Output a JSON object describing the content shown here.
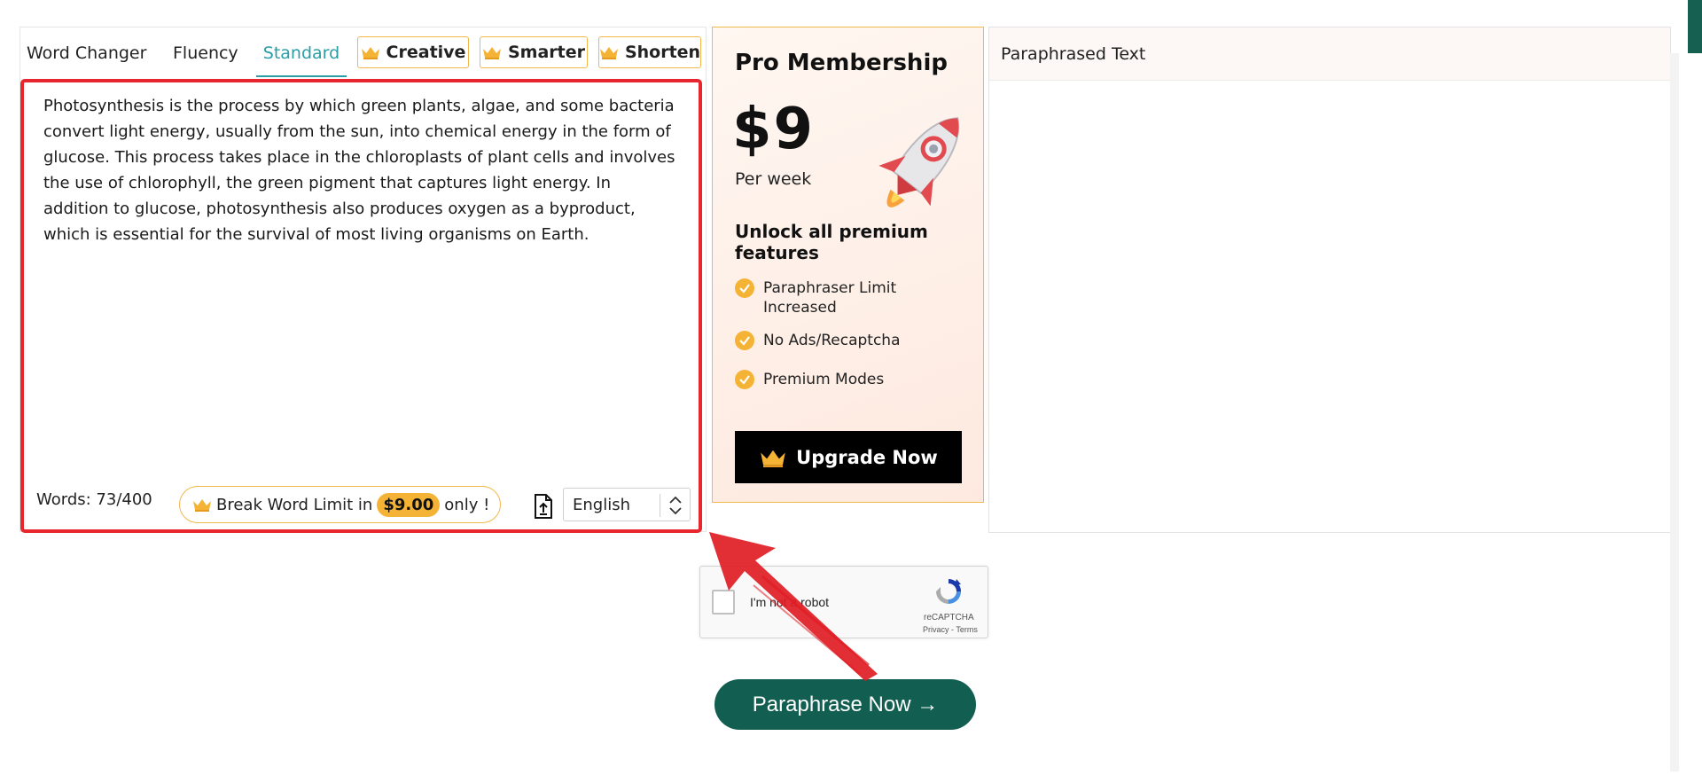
{
  "tabs": {
    "word_changer": "Word Changer",
    "fluency": "Fluency",
    "standard": "Standard",
    "creative": "Creative",
    "smarter": "Smarter",
    "shorten": "Shorten",
    "active": "Standard"
  },
  "editor": {
    "text": "Photosynthesis is the process by which green plants, algae, and some bacteria convert light energy, usually from the sun, into chemical energy in the form of glucose. This process takes place in the chloroplasts of plant cells and involves the use of chlorophyll, the green pigment that captures light energy. In addition to glucose, photosynthesis also produces oxygen as a byproduct, which is essential for the survival of most living organisms on Earth.",
    "word_count": "Words: 73/400",
    "break_limit_prefix": "Break Word Limit in",
    "break_limit_price": "$9.00",
    "break_limit_suffix": "only !",
    "language": "English"
  },
  "promo": {
    "title": "Pro Membership",
    "price": "$9",
    "period": "Per week",
    "subtitle": "Unlock all premium features",
    "features": [
      "Paraphraser Limit Increased",
      "No Ads/Recaptcha",
      "Premium Modes"
    ],
    "upgrade_label": "Upgrade Now"
  },
  "output": {
    "title": "Paraphrased Text",
    "text": ""
  },
  "captcha": {
    "label": "I'm not a robot",
    "brand": "reCAPTCHA",
    "links": "Privacy - Terms"
  },
  "cta": {
    "label": "Paraphrase Now →"
  },
  "colors": {
    "accent_teal": "#2a9da6",
    "premium_gold": "#f2b84b",
    "highlight_red": "#e8262e",
    "cta_green": "#125e50"
  },
  "icons": [
    "crown-icon",
    "upload-file-icon",
    "select-arrows-icon",
    "rocket-icon",
    "check-circle-icon",
    "recaptcha-logo-icon"
  ]
}
